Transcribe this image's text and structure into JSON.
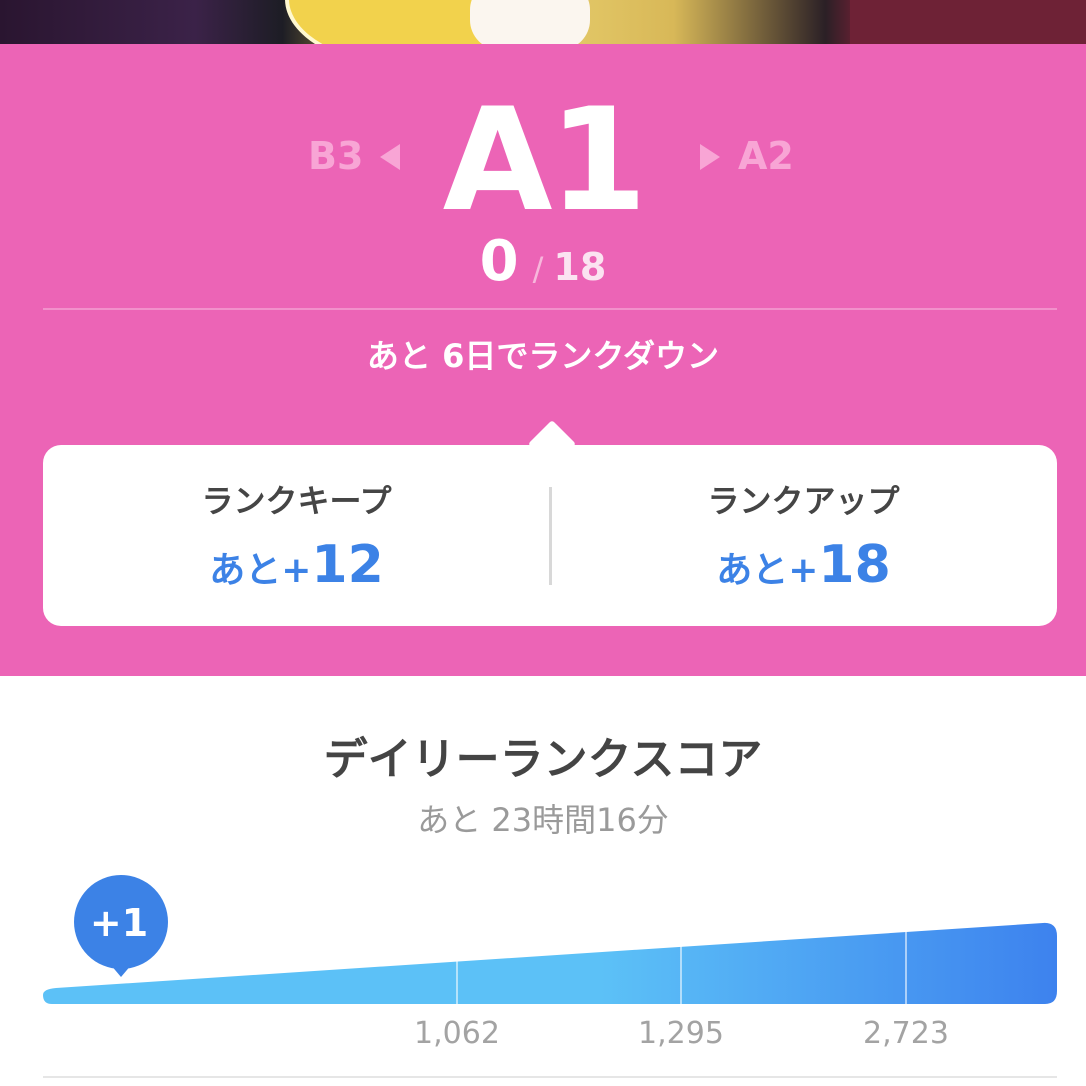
{
  "rank": {
    "current": "A1",
    "previous": "B3",
    "next": "A2",
    "progress_current": "0",
    "progress_slash": "/",
    "progress_total": "18",
    "rankdown_message": "あと 6日でランクダウン"
  },
  "card": {
    "keep": {
      "label": "ランクキープ",
      "prefix": "あと+",
      "value": "12"
    },
    "up": {
      "label": "ランクアップ",
      "prefix": "あと+",
      "value": "18"
    }
  },
  "daily": {
    "title": "デイリーランクスコア",
    "remaining": "あと 23時間16分",
    "marker_label": "+1"
  },
  "chart_data": {
    "type": "area",
    "current_score": 1,
    "thresholds": [
      1062,
      1295,
      2723
    ],
    "tick_labels": [
      "1,062",
      "1,295",
      "2,723"
    ]
  },
  "colors": {
    "rank_panel": "#ec64b6",
    "accent_blue": "#3c82e6",
    "bar_light": "#5cc1f7",
    "bar_dark": "#3d82ee"
  },
  "icons": {
    "prev_arrow": "triangle-left-icon",
    "next_arrow": "triangle-right-icon"
  }
}
